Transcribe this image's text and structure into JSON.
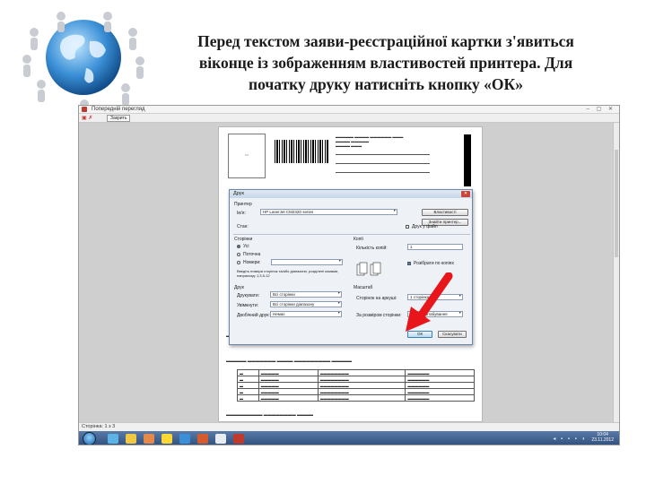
{
  "slide": {
    "title_lines": [
      "Перед текстом заяви-реєстраційної картки з'явиться",
      "віконце із зображенням властивостей принтера. Для",
      "початку друку натисніть кнопку «ОК»"
    ]
  },
  "preview_window": {
    "title": "Попередній перегляд",
    "toolbar_button": "Закрить",
    "statusbar": "Сторінка: 1 з 3",
    "tray_time": "10:04",
    "tray_date": "23.11.2012"
  },
  "print_dialog": {
    "title": "Друк",
    "printer_group": "Принтер",
    "name_label": "Ім'я:",
    "printer_name": "HP LaserJet CM2320 series",
    "properties_button": "Властивості",
    "find_printer_button": "Знайти принтер...",
    "status_label": "Стан:",
    "print_to_file": "Друк у файл",
    "pages_group": "Сторінки",
    "all_option": "Усі",
    "current_option": "Поточна",
    "pages_option": "Номери:",
    "pages_hint": "Введіть номери сторінок та/або діапазони, розділені комами, наприклад: 1,3,5-12",
    "copies_group": "Копії",
    "copies_label": "Кількість копій:",
    "copies_value": "1",
    "collate_label": "Розібрати по копіях",
    "print_section_label": "Друк",
    "print_what_label": "Друкувати:",
    "print_what_value": "Всі сторінки",
    "order_label": "Увімкнути:",
    "order_value": "Всі сторінки діапазону",
    "duplex_label": "Двобічний друк:",
    "duplex_value": "Немає",
    "scale_group": "Масштаб",
    "pages_per_sheet_label": "Сторінок на аркуші:",
    "pages_per_sheet_value": "1 сторінка",
    "fit_label": "За розміром сторінки:",
    "fit_value": "Без масштабування",
    "ok_button": "ОК",
    "cancel_button": "Скасувати"
  },
  "colors": {
    "arrow": "#e8151b",
    "taskbar": "#2e4d7a",
    "dialog_bg": "#eef2f7"
  }
}
